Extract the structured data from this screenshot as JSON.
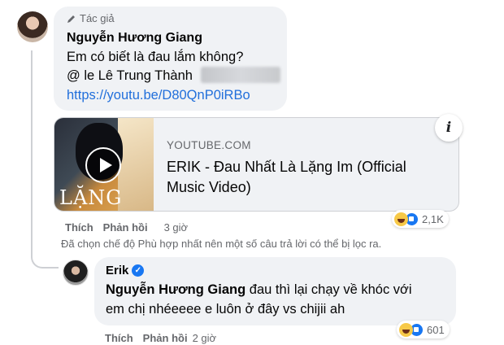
{
  "comment": {
    "author_badge": "Tác giả",
    "author": "Nguyễn Hương Giang",
    "line1": "Em có biết là đau lắm không?",
    "mention": "@ le Lê Trung Thành",
    "link": "https://youtu.be/D80QnP0iRBo",
    "card": {
      "domain": "YOUTUBE.COM",
      "title": "ERIK - Đau Nhất Là Lặng Im (Official Music Video)",
      "thumb_text": "LẶNG IM"
    },
    "actions": {
      "like": "Thích",
      "reply": "Phản hồi",
      "time": "3 giờ"
    },
    "reactions": "2,1K"
  },
  "notice": "Đã chọn chế độ Phù hợp nhất nên một số câu trả lời có thể bị lọc ra.",
  "reply": {
    "author": "Erik",
    "mention": "Nguyễn Hương Giang",
    "text1": " đau thì lại chạy về khóc với",
    "text2": "em chị nhéeeee e luôn ở đây vs chijii ah",
    "actions": {
      "like": "Thích",
      "reply": "Phản hồi",
      "time": "2 giờ"
    },
    "reactions": "601"
  }
}
